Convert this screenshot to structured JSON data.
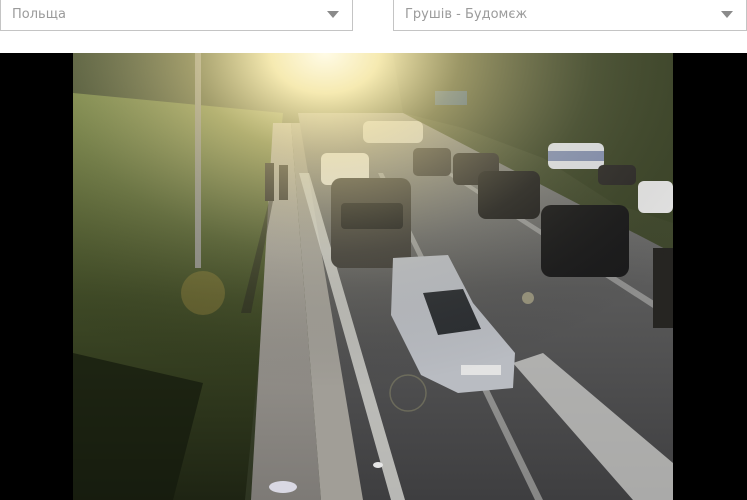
{
  "filters": {
    "country": {
      "selected": "Польща"
    },
    "crossing": {
      "selected": "Грушів - Будомєж"
    }
  },
  "camera": {
    "sign_text": ""
  },
  "icons": {
    "dropdown": "chevron-down-icon"
  },
  "colors": {
    "frame_background": "#000000",
    "select_border": "#c4c4c4",
    "select_text": "#9b9b9b"
  }
}
